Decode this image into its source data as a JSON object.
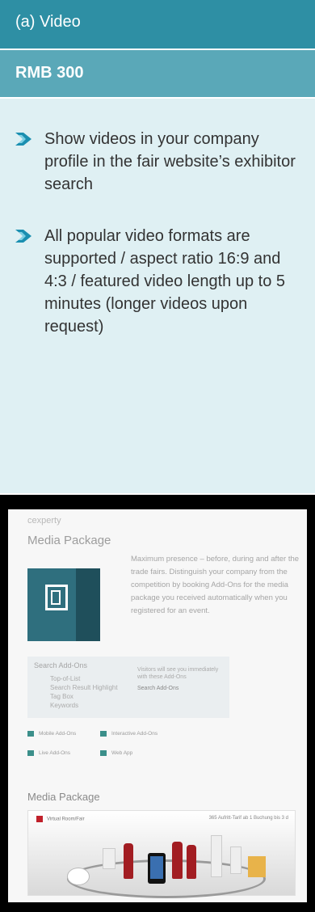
{
  "header": {
    "title": "(a) Video"
  },
  "price": {
    "label": "RMB 300"
  },
  "features": [
    "Show videos in your company profile in the fair website’s exhibitor search",
    "All popular video formats are supported / aspect ratio 16:9 and 4:3 / featured video length up to 5 minutes (longer videos upon request)"
  ],
  "colors": {
    "header_bg": "#2e8fa4",
    "price_bg": "#5aa8b8",
    "panel_bg": "#dff0f3",
    "arrow": "#1a8fb0"
  },
  "photo": {
    "brand": "cexperty",
    "title_top": "Media Package",
    "intro": "Maximum presence – before, during and after the trade fairs. Distinguish your company from the competition by booking Add-Ons for the media package you received automatically when you registered for an event.",
    "addons_title": "Search Add-Ons",
    "addons_items": [
      "Top-of-List",
      "Search Result Highlight",
      "Tag Box",
      "Keywords"
    ],
    "addons_note": "Visitors will see you immediately with these Add-Ons",
    "addons_link": "Search Add-Ons",
    "options": [
      "Mobile Add-Ons",
      "Interactive Add-Ons",
      "Live Add-Ons",
      "Web App"
    ],
    "title_bottom": "Media Package",
    "scene_left": "Virtual Room/Fair",
    "scene_right": "365 Aufritt-Tarif ab 1 Buchung bis 3 d"
  }
}
